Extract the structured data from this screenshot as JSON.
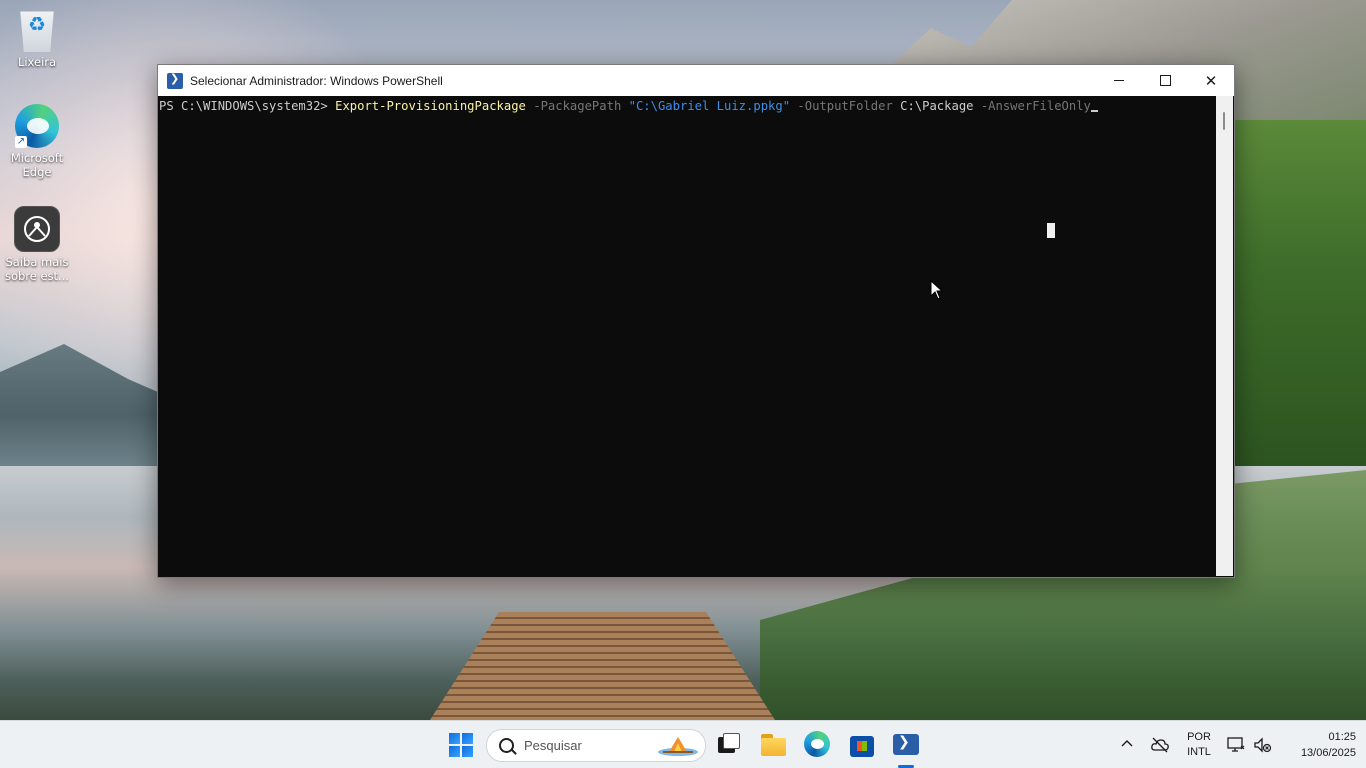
{
  "desktop": {
    "icons": [
      {
        "label": "Lixeira"
      },
      {
        "label": "Microsoft Edge"
      },
      {
        "label": "Saiba mais sobre est..."
      }
    ]
  },
  "window": {
    "title": "Selecionar Administrador: Windows PowerShell",
    "console": {
      "prompt": "PS C:\\WINDOWS\\system32> ",
      "command": "Export-ProvisioningPackage",
      "param_package_path": " -PackagePath ",
      "package_path_value": "\"C:\\Gabriel Luiz.ppkg\"",
      "param_output_folder": " -OutputFolder ",
      "output_folder_value": "C:\\Package",
      "param_answer_file": " -AnswerFileOnly"
    },
    "colors": {
      "console_bg": "#0c0c0c",
      "command": "#f9f1a5",
      "parameter": "#767676",
      "string": "#3b8eea",
      "default_text": "#cccccc"
    }
  },
  "taskbar": {
    "search_placeholder": "Pesquisar",
    "apps": [
      "task-view-icon",
      "file-explorer-icon",
      "edge-icon",
      "store-icon",
      "powershell-icon"
    ],
    "tray": {
      "lang_line1": "POR",
      "lang_line2": "INTL",
      "time": "01:25",
      "date": "13/06/2025"
    }
  }
}
